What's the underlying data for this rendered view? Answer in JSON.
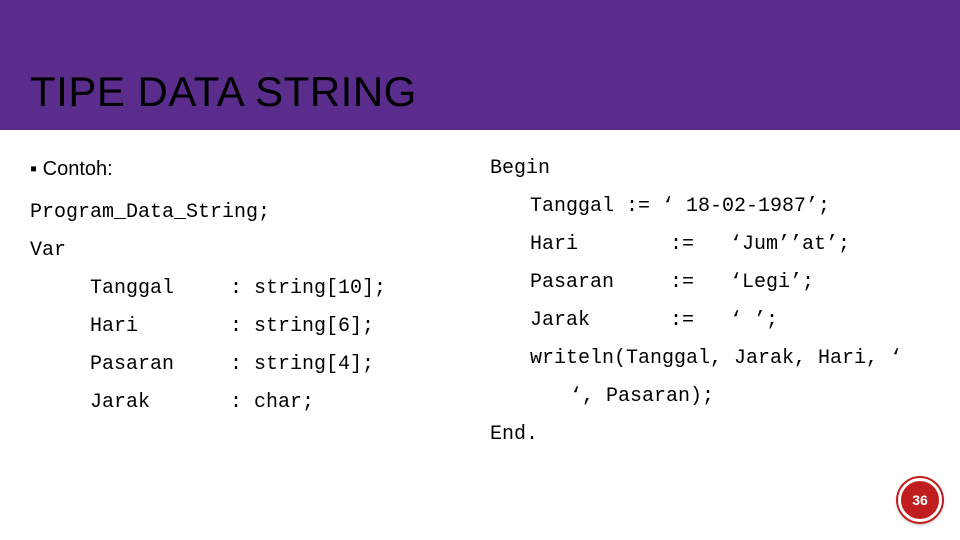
{
  "title": "TIPE DATA STRING",
  "contoh_label": "Contoh:",
  "left": {
    "program_line": "Program_Data_String;",
    "var_kw": "Var",
    "decls": [
      {
        "name": "Tanggal",
        "type": ": string[10];"
      },
      {
        "name": "Hari",
        "type": ": string[6];"
      },
      {
        "name": "Pasaran",
        "type": ": string[4];"
      },
      {
        "name": "Jarak",
        "type": ": char;"
      }
    ]
  },
  "right": {
    "begin_kw": "Begin",
    "first_assign_combined": "Tanggal     := ‘ 18-02-1987’;",
    "assigns": [
      {
        "name": "Hari",
        "op": ":=",
        "val": "‘Jum’’at’;"
      },
      {
        "name": "Pasaran",
        "op": ":=",
        "val": "‘Legi’;"
      },
      {
        "name": "Jarak",
        "op": ":=",
        "val": "‘ ’;"
      }
    ],
    "writeln": "writeln(Tanggal, Jarak, Hari, ‘ ‘, Pasaran);",
    "end_kw": "End."
  },
  "page_number": "36"
}
